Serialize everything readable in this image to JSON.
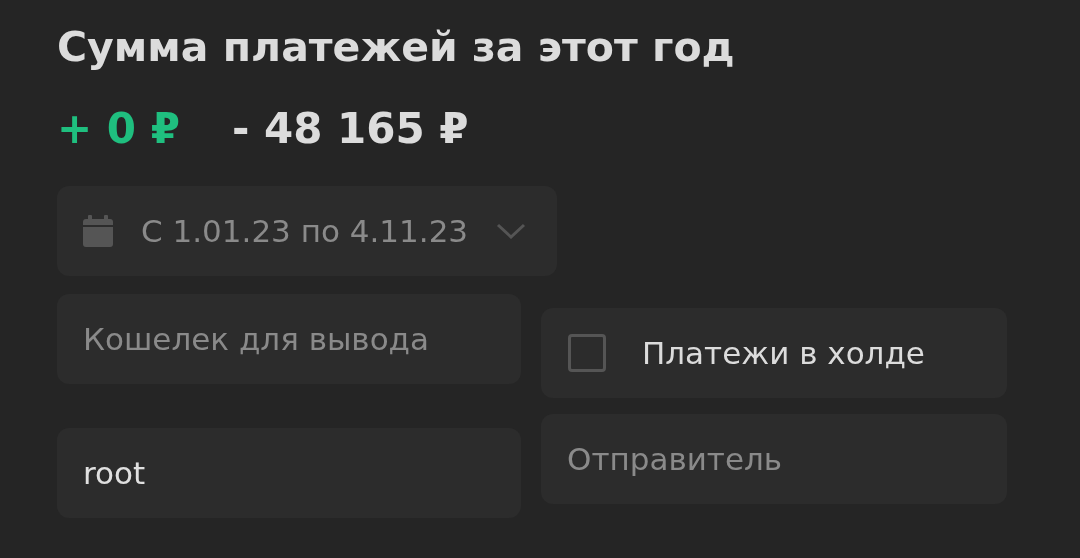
{
  "title": "Сумма платежей за этот год",
  "totals": [
    {
      "text": "+ 0 ₽",
      "kind": "income"
    },
    {
      "text": "- 48 165 ₽",
      "kind": "expense"
    }
  ],
  "date_range": {
    "value": "С 1.01.23 по 4.11.23"
  },
  "wallet_field": {
    "placeholder": "Кошелек для вывода"
  },
  "hold_checkbox": {
    "label": "Платежи в холде",
    "checked": false
  },
  "login_field": {
    "value": "root"
  },
  "sender_field": {
    "placeholder": "Отправитель"
  }
}
